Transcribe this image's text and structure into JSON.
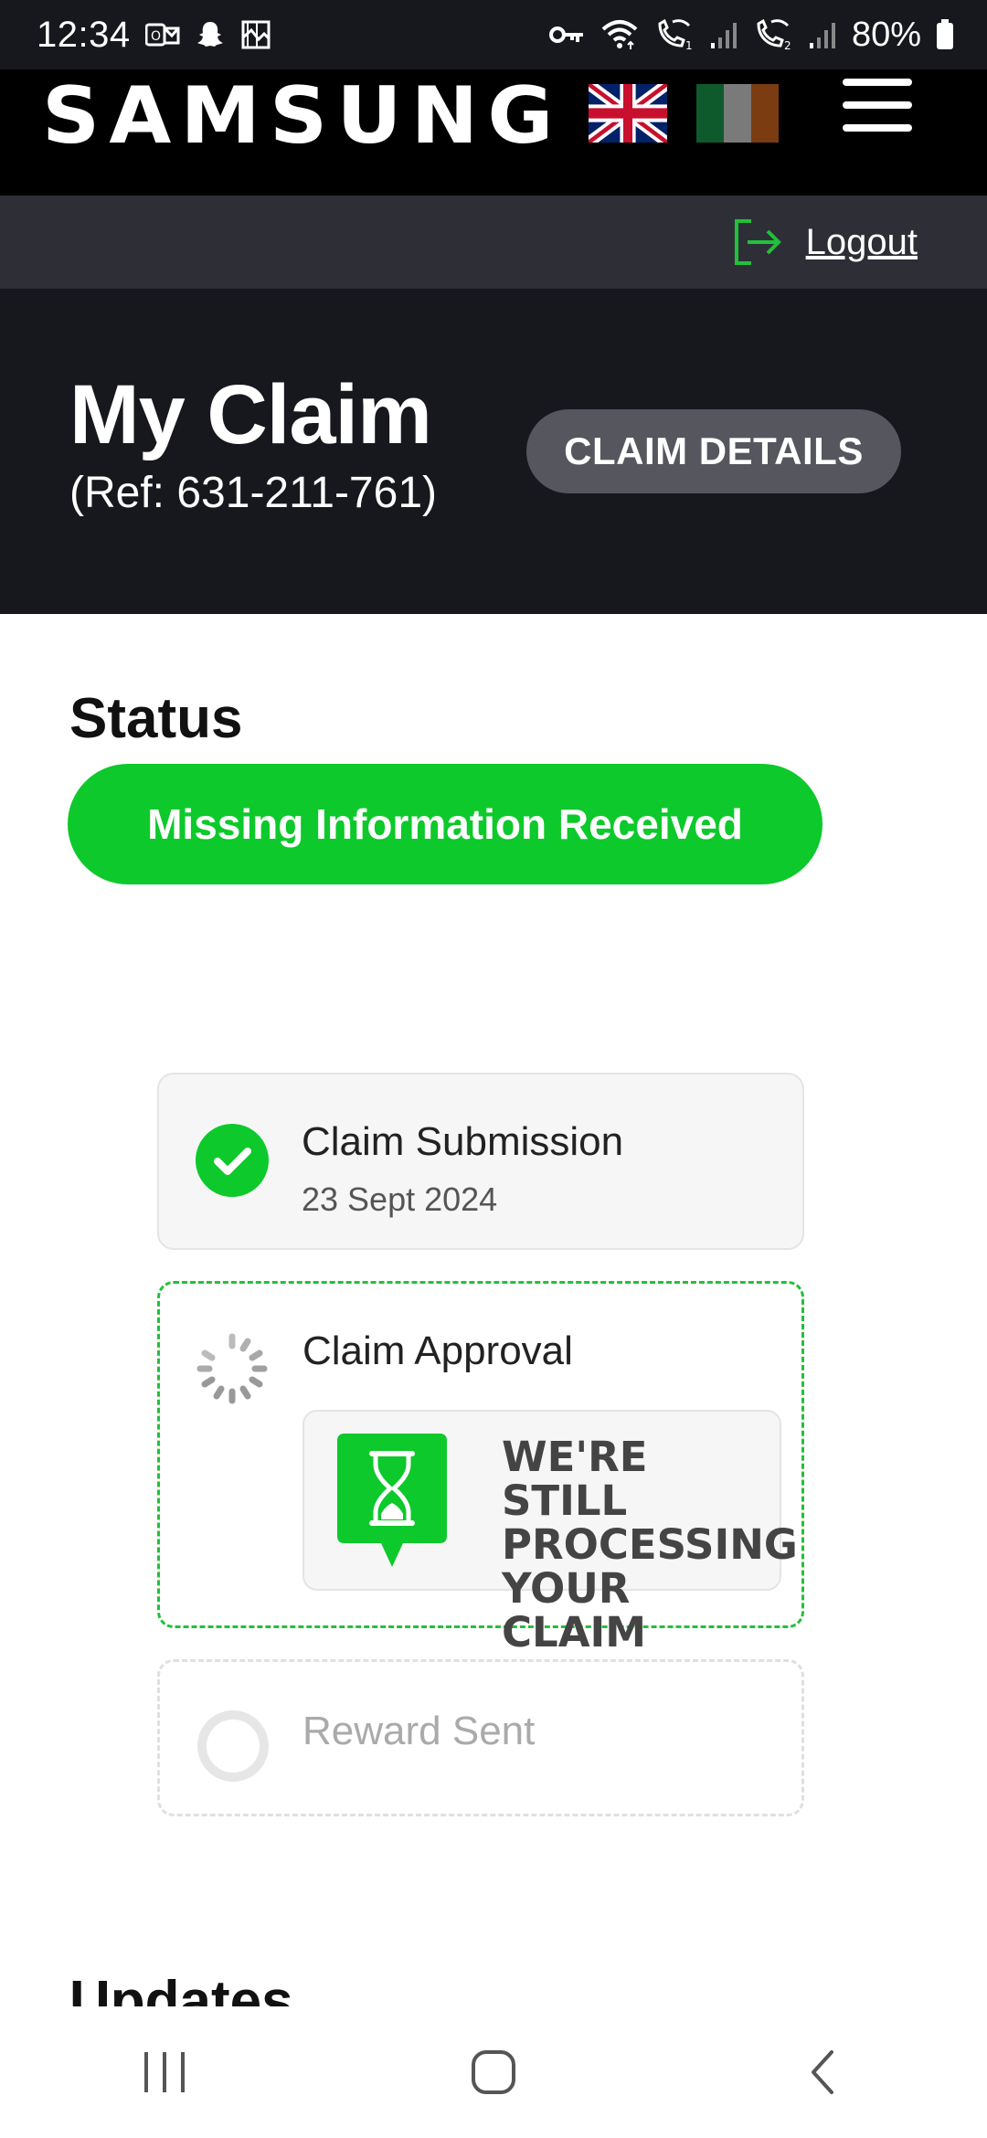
{
  "status_bar": {
    "time": "12:34",
    "battery": "80%",
    "left_icons": [
      "outlook-icon",
      "snapchat-icon",
      "gallery-icon"
    ],
    "right_icons": [
      "vpn-key-icon",
      "wifi-icon",
      "wifi-call-sim1-icon",
      "signal-sim1-icon",
      "wifi-call-sim2-icon",
      "signal-sim2-icon",
      "battery-icon"
    ]
  },
  "header": {
    "logo": "SAMSUNG",
    "languages": [
      "uk-flag",
      "ireland-flag"
    ],
    "colors": {
      "ireland_green": "#0f5a2c",
      "ireland_white": "#7a7a7a",
      "ireland_orange": "#7a3c10"
    }
  },
  "logout": {
    "label": "Logout"
  },
  "hero": {
    "title": "My Claim",
    "ref": "(Ref: 631-211-761)",
    "details_button": "CLAIM DETAILS"
  },
  "status": {
    "heading": "Status",
    "value": "Missing Information Received",
    "color": "#0dc92b"
  },
  "timeline": {
    "steps": [
      {
        "title": "Claim Submission",
        "date": "23 Sept 2024",
        "state": "complete"
      },
      {
        "title": "Claim Approval",
        "state": "in-progress",
        "message": [
          "WE'RE STILL",
          "PROCESSING",
          "YOUR CLAIM"
        ]
      },
      {
        "title": "Reward Sent",
        "state": "pending"
      }
    ]
  },
  "updates": {
    "heading": "Updates"
  },
  "nav": [
    "recent-apps-icon",
    "home-icon",
    "back-icon"
  ]
}
